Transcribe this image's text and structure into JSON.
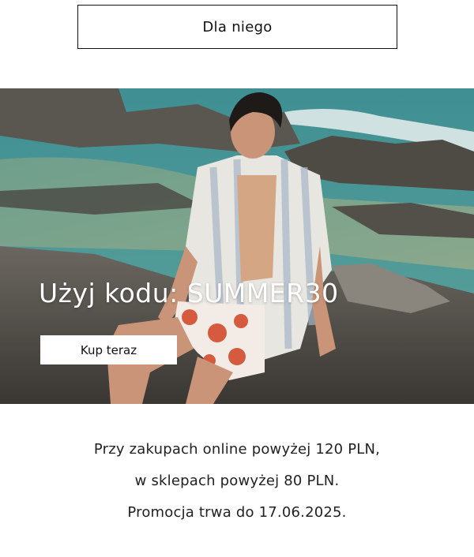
{
  "top_button": {
    "label": "Dla niego"
  },
  "hero": {
    "headline": "Użyj kodu: SUMMER30",
    "cta_label": "Kup teraz"
  },
  "terms": {
    "line1": "Przy zakupach online powyżej 120 PLN,",
    "line2": "w sklepach powyżej 80 PLN.",
    "line3": "Promocja trwa do 17.06.2025."
  }
}
